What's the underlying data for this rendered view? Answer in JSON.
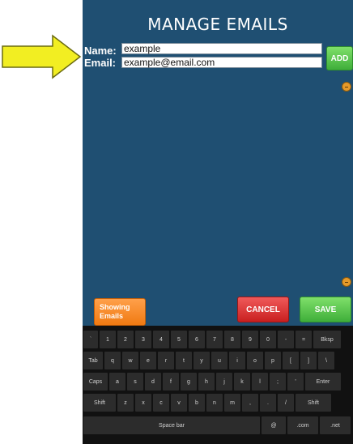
{
  "title": "MANAGE EMAILS",
  "form": {
    "name_label": "Name:",
    "name_value": "example",
    "email_label": "Email:",
    "email_value": "example@email.com"
  },
  "buttons": {
    "add": "ADD",
    "showing_emails": "Showing Emails",
    "cancel": "CANCEL",
    "save": "SAVE"
  },
  "keyboard": {
    "rows": [
      [
        "`",
        "1",
        "2",
        "3",
        "4",
        "5",
        "6",
        "7",
        "8",
        "9",
        "0",
        "-",
        "=",
        "Bksp"
      ],
      [
        "Tab",
        "q",
        "w",
        "e",
        "r",
        "t",
        "y",
        "u",
        "i",
        "o",
        "p",
        "[",
        "]",
        "\\"
      ],
      [
        "Caps",
        "a",
        "s",
        "d",
        "f",
        "g",
        "h",
        "j",
        "k",
        "l",
        ";",
        "'",
        "Enter"
      ],
      [
        "Shift",
        "z",
        "x",
        "c",
        "v",
        "b",
        "n",
        "m",
        ",",
        ".",
        "/",
        "Shift"
      ],
      [
        "Space bar",
        "@",
        ".com",
        ".net"
      ]
    ]
  },
  "colors": {
    "app_background": "#1f4f72",
    "add_button": "#4cbf45",
    "showing_button": "#f28a20",
    "cancel_button": "#d93232",
    "save_button": "#4cbf45",
    "arrow_fill": "#f2ee22"
  },
  "icons": {
    "pointer": "arrow-right-icon",
    "scroll_knob": "scroll-knob-icon"
  }
}
